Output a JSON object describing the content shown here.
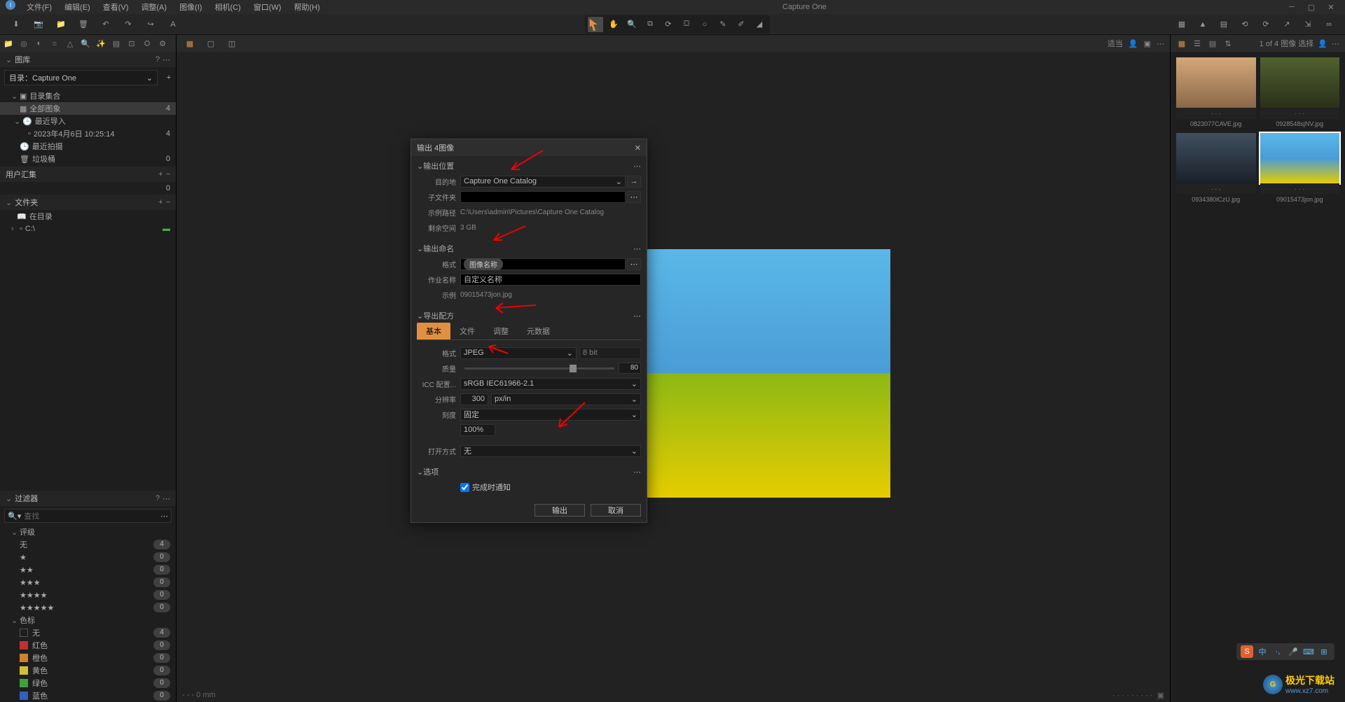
{
  "app_title": "Capture One",
  "menu": [
    "文件(F)",
    "编辑(E)",
    "查看(V)",
    "调整(A)",
    "图像(I)",
    "相机(C)",
    "窗口(W)",
    "帮助(H)"
  ],
  "library_panel": {
    "title": "图库",
    "catalog_label": "目录：Capture One",
    "sections": {
      "catalog_set": "目录集合",
      "all_images": "全部图象",
      "all_images_count": "4",
      "recent_import": "最近导入",
      "recent_import_date": "2023年4月6日 10:25:14",
      "recent_import_count": "4",
      "recent_capture": "最近拍摄",
      "trash": "垃圾桶",
      "trash_count": "0",
      "user_collection": "用户汇集",
      "user_collection_count": "0",
      "folders": "文件夹",
      "in_catalog": "在目录",
      "drive": "C:\\"
    }
  },
  "filter_panel": {
    "title": "过滤器",
    "search_placeholder": "查找",
    "rating_section": "评级",
    "rating_none": "无",
    "rating_none_count": "4",
    "rating_counts": [
      "0",
      "0",
      "0",
      "0",
      "0"
    ],
    "color_section": "色标",
    "colors": [
      {
        "name": "无",
        "hex": "",
        "count": "4"
      },
      {
        "name": "红色",
        "hex": "#c03030",
        "count": "0"
      },
      {
        "name": "橙色",
        "hex": "#d08030",
        "count": "0"
      },
      {
        "name": "黄色",
        "hex": "#d0c030",
        "count": "0"
      },
      {
        "name": "绿色",
        "hex": "#40a040",
        "count": "0"
      },
      {
        "name": "蓝色",
        "hex": "#3060c0",
        "count": "0"
      }
    ]
  },
  "viewer": {
    "proof_label": "适当",
    "status_left": "- - - 0 mm",
    "status_center": ""
  },
  "browser": {
    "count_label": "1 of 4 图像 选择",
    "thumbs": [
      {
        "name": "0823077CAVE.jpg"
      },
      {
        "name": "0928548sjNV.jpg"
      },
      {
        "name": "0934380lCzU.jpg"
      },
      {
        "name": "09015473jon.jpg"
      }
    ]
  },
  "dialog": {
    "title": "输出 4图像",
    "output_location": {
      "header": "输出位置",
      "destination_label": "目的地",
      "destination_value": "Capture One Catalog",
      "subfolder_label": "子文件夹",
      "subfolder_value": "",
      "path_label": "示例路径",
      "path_value": "C:\\Users\\admin\\Pictures\\Capture One Catalog",
      "space_label": "剩余空间",
      "space_value": "3 GB"
    },
    "output_naming": {
      "header": "输出命名",
      "format_label": "格式",
      "format_token": "图像名称",
      "jobname_label": "作业名称",
      "jobname_value": "自定义名称",
      "sample_label": "示例",
      "sample_value": "09015473jon.jpg"
    },
    "recipe": {
      "header": "导出配方",
      "tabs": [
        "基本",
        "文件",
        "调整",
        "元数据"
      ],
      "format_label": "格式",
      "format_value": "JPEG",
      "bit_depth": "8 bit",
      "quality_label": "质量",
      "quality_value": "80",
      "icc_label": "ICC 配置...",
      "icc_value": "sRGB IEC61966-2.1",
      "resolution_label": "分辨率",
      "resolution_value": "300",
      "resolution_unit": "px/in",
      "scale_label": "刻度",
      "scale_value": "固定",
      "scale_percent": "100%",
      "open_label": "打开方式",
      "open_value": "无"
    },
    "options": {
      "header": "选项",
      "notify": "完成时通知"
    },
    "buttons": {
      "export": "输出",
      "cancel": "取消"
    }
  },
  "watermark": {
    "line1": "极光下载站",
    "line2": "www.xz7.com"
  }
}
